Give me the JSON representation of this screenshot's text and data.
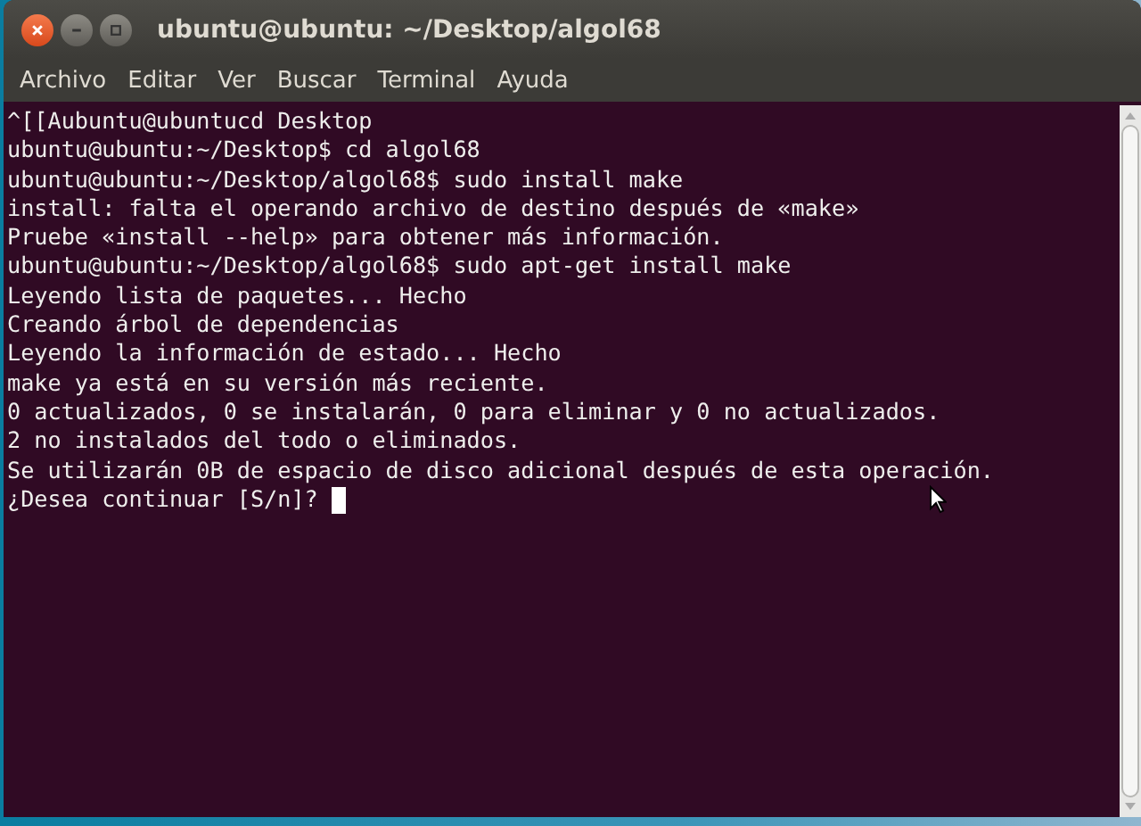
{
  "window": {
    "title": "ubuntu@ubuntu: ~/Desktop/algol68"
  },
  "menu": [
    "Archivo",
    "Editar",
    "Ver",
    "Buscar",
    "Terminal",
    "Ayuda"
  ],
  "terminal": {
    "lines": [
      "^[[Aubuntu@ubuntucd Desktop",
      "ubuntu@ubuntu:~/Desktop$ cd algol68",
      "ubuntu@ubuntu:~/Desktop/algol68$ sudo install make",
      "install: falta el operando archivo de destino después de «make»",
      "Pruebe «install --help» para obtener más información.",
      "ubuntu@ubuntu:~/Desktop/algol68$ sudo apt-get install make",
      "Leyendo lista de paquetes... Hecho",
      "Creando árbol de dependencias",
      "Leyendo la información de estado... Hecho",
      "make ya está en su versión más reciente.",
      "0 actualizados, 0 se instalarán, 0 para eliminar y 0 no actualizados.",
      "2 no instalados del todo o eliminados.",
      "Se utilizarán 0B de espacio de disco adicional después de esta operación.",
      "¿Desea continuar [S/n]?"
    ]
  }
}
